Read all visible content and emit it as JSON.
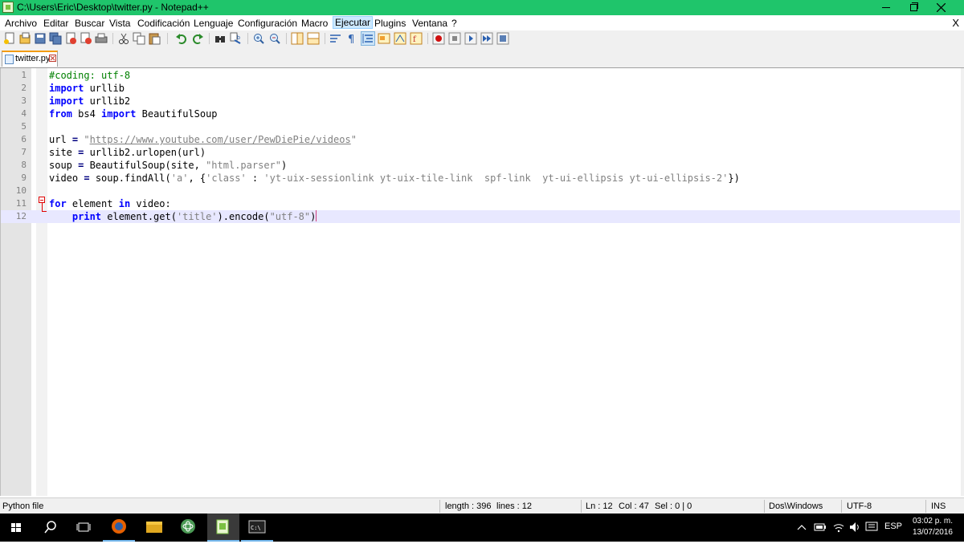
{
  "window": {
    "title": "C:\\Users\\Eric\\Desktop\\twitter.py - Notepad++"
  },
  "menu": {
    "items": [
      "Archivo",
      "Editar",
      "Buscar",
      "Vista",
      "Codificación",
      "Lenguaje",
      "Configuración",
      "Macro",
      "Ejecutar",
      "Plugins",
      "Ventana",
      "?"
    ],
    "active": "Ejecutar",
    "close_label": "X"
  },
  "toolbar": {
    "icons": [
      "new-file-icon",
      "open-file-icon",
      "save-icon",
      "save-all-icon",
      "close-icon",
      "close-all-icon",
      "print-icon",
      "cut-icon",
      "copy-icon",
      "paste-icon",
      "undo-icon",
      "redo-icon",
      "find-icon",
      "replace-icon",
      "zoom-in-icon",
      "zoom-out-icon",
      "sync-vertical-icon",
      "sync-horizontal-icon",
      "word-wrap-icon",
      "show-all-chars-icon",
      "indent-guide-icon",
      "user-lang-icon",
      "doc-map-icon",
      "function-list-icon",
      "record-macro-icon",
      "stop-record-icon",
      "play-macro-icon",
      "run-macro-multiple-icon",
      "save-macro-icon"
    ]
  },
  "tab": {
    "label": "twitter.py"
  },
  "editor": {
    "line_numbers": [
      "1",
      "2",
      "3",
      "4",
      "5",
      "6",
      "7",
      "8",
      "9",
      "10",
      "11",
      "12"
    ],
    "lines": [
      [
        {
          "t": "#coding: utf-8",
          "c": "cm"
        }
      ],
      [
        {
          "t": "import",
          "c": "kw"
        },
        {
          "t": " urllib",
          "c": ""
        }
      ],
      [
        {
          "t": "import",
          "c": "kw"
        },
        {
          "t": " urllib2",
          "c": ""
        }
      ],
      [
        {
          "t": "from",
          "c": "kw"
        },
        {
          "t": " bs4 ",
          "c": ""
        },
        {
          "t": "import",
          "c": "kw"
        },
        {
          "t": " BeautifulSoup",
          "c": ""
        }
      ],
      [],
      [
        {
          "t": "url ",
          "c": ""
        },
        {
          "t": "=",
          "c": "op"
        },
        {
          "t": " \"",
          "c": "st"
        },
        {
          "t": "https://www.youtube.com/user/PewDiePie/videos",
          "c": "url"
        },
        {
          "t": "\"",
          "c": "st"
        }
      ],
      [
        {
          "t": "site ",
          "c": ""
        },
        {
          "t": "=",
          "c": "op"
        },
        {
          "t": " urllib2.urlopen(url)",
          "c": ""
        }
      ],
      [
        {
          "t": "soup ",
          "c": ""
        },
        {
          "t": "=",
          "c": "op"
        },
        {
          "t": " BeautifulSoup(site, ",
          "c": ""
        },
        {
          "t": "\"html.parser\"",
          "c": "st"
        },
        {
          "t": ")",
          "c": ""
        }
      ],
      [
        {
          "t": "video ",
          "c": ""
        },
        {
          "t": "=",
          "c": "op"
        },
        {
          "t": " soup.findAll(",
          "c": ""
        },
        {
          "t": "'a'",
          "c": "st"
        },
        {
          "t": ", {",
          "c": ""
        },
        {
          "t": "'class'",
          "c": "st"
        },
        {
          "t": " : ",
          "c": ""
        },
        {
          "t": "'yt-uix-sessionlink yt-uix-tile-link  spf-link  yt-ui-ellipsis yt-ui-ellipsis-2'",
          "c": "st"
        },
        {
          "t": "})",
          "c": ""
        }
      ],
      [],
      [
        {
          "t": "for",
          "c": "kw"
        },
        {
          "t": " element ",
          "c": ""
        },
        {
          "t": "in",
          "c": "kw"
        },
        {
          "t": " video:",
          "c": ""
        }
      ],
      [
        {
          "t": "    ",
          "c": ""
        },
        {
          "t": "print",
          "c": "kw"
        },
        {
          "t": " element.get(",
          "c": ""
        },
        {
          "t": "'title'",
          "c": "st"
        },
        {
          "t": ").encode(",
          "c": ""
        },
        {
          "t": "\"utf-8\"",
          "c": "st"
        },
        {
          "t": ")",
          "c": ""
        }
      ]
    ]
  },
  "statusbar": {
    "filetype": "Python file",
    "length": "length : 396",
    "lines": "lines : 12",
    "ln": "Ln : 12",
    "col": "Col : 47",
    "sel": "Sel : 0 | 0",
    "eol": "Dos\\Windows",
    "encoding": "UTF-8",
    "mode": "INS"
  },
  "taskbar": {
    "language": "ESP",
    "time": "03:02 p. m.",
    "date": "13/07/2016"
  },
  "colors": {
    "titlebar": "#1fc56b",
    "keyword": "#0000ff",
    "comment": "#008000",
    "string": "#808080"
  }
}
